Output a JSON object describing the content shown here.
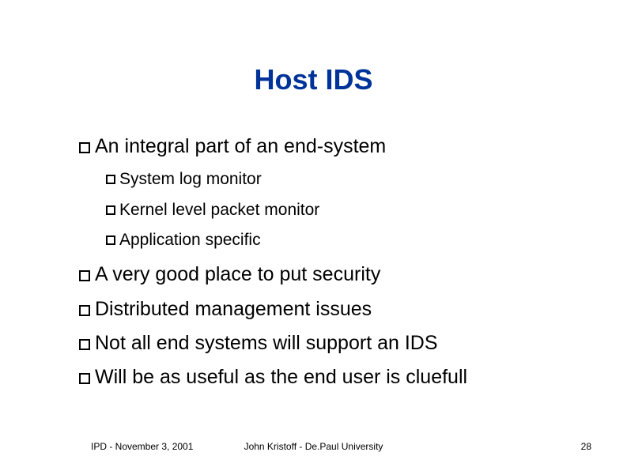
{
  "title": "Host IDS",
  "bullets": [
    {
      "text": "An integral part of an end-system",
      "sub": [
        "System log monitor",
        "Kernel level packet monitor",
        "Application specific"
      ]
    },
    {
      "text": "A very good place to put security"
    },
    {
      "text": "Distributed management issues"
    },
    {
      "text": "Not all end systems will support an IDS"
    },
    {
      "text": "Will be as useful as the end user is cluefull"
    }
  ],
  "footer": {
    "left": "IPD - November 3, 2001",
    "center": "John Kristoff - De.Paul University",
    "right": "28"
  }
}
